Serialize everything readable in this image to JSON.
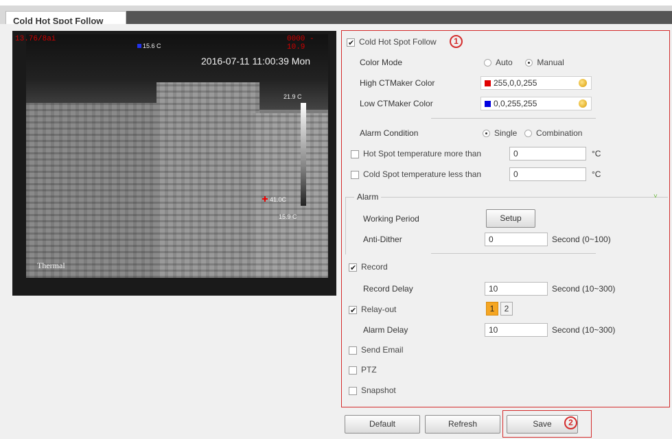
{
  "tab": {
    "title": "Cold Hot Spot Follow"
  },
  "video": {
    "top_left": "13.76/8ai",
    "top_right": "0000 - 10.9",
    "cold_temp": "15.6 C",
    "timestamp": "2016-07-11 11:00:39 Mon",
    "scale_top": "21.9 C",
    "hot_temp": "41.0C",
    "scale_bottom": "15.9 C",
    "mode": "Thermal"
  },
  "panel": {
    "annotation_1": "1",
    "cold_hot_follow": {
      "label": "Cold Hot Spot Follow",
      "checked": true
    },
    "color_mode": {
      "label": "Color Mode",
      "options": [
        "Auto",
        "Manual"
      ],
      "selected": "Manual"
    },
    "high_color": {
      "label": "High CTMaker Color",
      "value": "255,0,0,255",
      "swatch": "#e00000"
    },
    "low_color": {
      "label": "Low CTMaker Color",
      "value": "0,0,255,255",
      "swatch": "#0000e0"
    },
    "alarm_condition": {
      "label": "Alarm Condition",
      "options": [
        "Single",
        "Combination"
      ],
      "selected": "Single"
    },
    "hot_spot": {
      "label": "Hot Spot temperature more than",
      "value": "0",
      "unit": "°C",
      "checked": false
    },
    "cold_spot": {
      "label": "Cold Spot temperature less than",
      "value": "0",
      "unit": "°C",
      "checked": false
    },
    "alarm": {
      "title": "Alarm",
      "working_period": {
        "label": "Working Period",
        "button": "Setup"
      },
      "anti_dither": {
        "label": "Anti-Dither",
        "value": "0",
        "unit": "Second (0~100)"
      }
    },
    "record": {
      "label": "Record",
      "checked": true
    },
    "record_delay": {
      "label": "Record Delay",
      "value": "10",
      "unit": "Second (10~300)"
    },
    "relay_out": {
      "label": "Relay-out",
      "checked": true,
      "channels": [
        "1",
        "2"
      ],
      "active": "1"
    },
    "alarm_delay": {
      "label": "Alarm Delay",
      "value": "10",
      "unit": "Second (10~300)"
    },
    "send_email": {
      "label": "Send Email",
      "checked": false
    },
    "ptz": {
      "label": "PTZ",
      "checked": false
    },
    "snapshot": {
      "label": "Snapshot",
      "checked": false
    }
  },
  "buttons": {
    "default": "Default",
    "refresh": "Refresh",
    "save": "Save",
    "annotation_2": "2"
  }
}
